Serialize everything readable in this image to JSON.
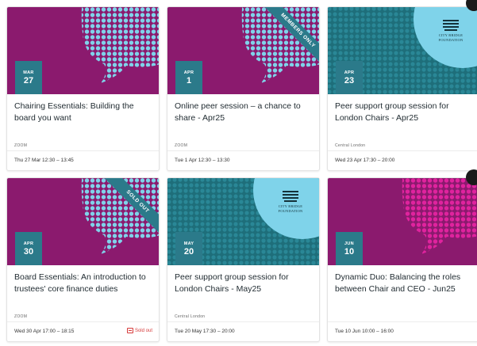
{
  "colors": {
    "purple": "#8b1a6e",
    "teal_dark": "#1e6e7a",
    "teal_badge": "#2b7a8a",
    "light_blue": "#7fd3ea",
    "magenta": "#e0239e",
    "sold_out_red": "#d63a3a"
  },
  "events": [
    {
      "month": "MAR",
      "day": "27",
      "title": "Chairing Essentials: Building the board you want",
      "venue": "ZOOM",
      "when": "Thu 27 Mar 12:30 – 13:45",
      "theme": "purple-blue",
      "ribbon": "",
      "logo": false,
      "sold_out": false
    },
    {
      "month": "APR",
      "day": "1",
      "title": "Online peer session – a chance to share - Apr25",
      "venue": "ZOOM",
      "when": "Tue 1 Apr 12:30 – 13:30",
      "theme": "purple-blue",
      "ribbon": "MEMBERS ONLY",
      "logo": false,
      "sold_out": false
    },
    {
      "month": "APR",
      "day": "23",
      "title": "Peer support group session for London Chairs - Apr25",
      "venue": "Central London",
      "when": "Wed 23 Apr 17:30 – 20:00",
      "theme": "teal-blue",
      "ribbon": "",
      "logo": true,
      "sold_out": false
    },
    {
      "month": "APR",
      "day": "30",
      "title": "Board Essentials: An introduction to trustees' core finance duties",
      "venue": "ZOOM",
      "when": "Wed 30 Apr 17:00 – 18:15",
      "theme": "purple-blue",
      "ribbon": "SOLD OUT",
      "logo": false,
      "sold_out": true
    },
    {
      "month": "MAY",
      "day": "20",
      "title": "Peer support group session for London Chairs - May25",
      "venue": "Central London",
      "when": "Tue 20 May 17:30 – 20:00",
      "theme": "teal-blue",
      "ribbon": "",
      "logo": true,
      "sold_out": false
    },
    {
      "month": "JUN",
      "day": "10",
      "title": "Dynamic Duo: Balancing the roles between Chair and CEO - Jun25",
      "venue": "",
      "when": "Tue 10 Jun 10:00 – 16:00",
      "theme": "purple-magenta",
      "ribbon": "",
      "logo": false,
      "sold_out": false
    }
  ],
  "logo_name": "CITY BRIDGE FOUNDATION",
  "sold_out_label": "Sold out"
}
